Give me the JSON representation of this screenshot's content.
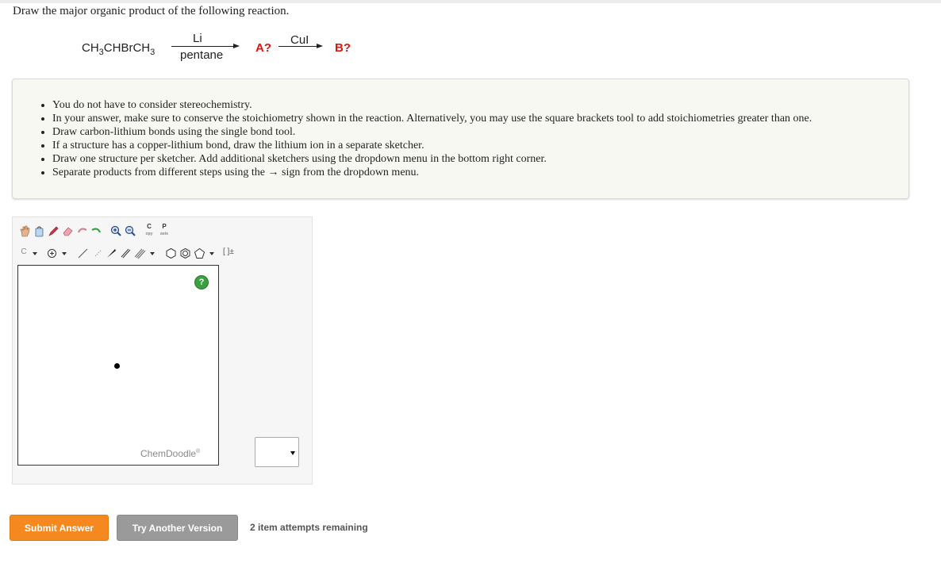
{
  "question": "Draw the major organic product of the following reaction.",
  "reaction": {
    "reactant_parts": [
      "CH",
      "3",
      "CHBrCH",
      "3"
    ],
    "step1_above": "Li",
    "step1_below": "pentane",
    "intermediate": "A?",
    "step2_above": "CuI",
    "product": "B?"
  },
  "instructions": [
    "You do not have to consider stereochemistry.",
    "In your answer, make sure to conserve the stoichiometry shown in the reaction. Alternatively, you may use the square brackets tool to add stoichiometries greater than one.",
    "Draw carbon-lithium bonds using the single bond tool.",
    "If a structure has a copper-lithium bond, draw the lithium ion in a separate sketcher.",
    "Draw one structure per sketcher. Add additional sketchers using the dropdown menu in the bottom right corner.",
    "Separate products from different steps using the → sign from the dropdown menu."
  ],
  "sketcher": {
    "element_label": "C",
    "copy_label": "C",
    "copy_sub": "opy",
    "paste_label": "P",
    "paste_sub": "aste",
    "brackets_label": "[ ]±",
    "help": "?",
    "brand": "ChemDoodle",
    "brand_mark": "®"
  },
  "buttons": {
    "submit": "Submit Answer",
    "another": "Try Another Version"
  },
  "attempts": "2 item attempts remaining",
  "colors": {
    "accent_orange": "#f5891f",
    "secondary_gray": "#9a9a9a",
    "reaction_red": "#e0140f",
    "help_green": "#3aa040"
  }
}
